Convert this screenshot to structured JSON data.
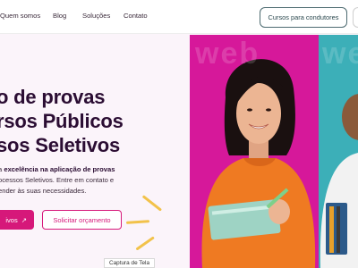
{
  "nav": {
    "items": [
      "Quem somos",
      "Blog",
      "Soluções",
      "Contato"
    ],
    "cta": "Cursos para condutores"
  },
  "hero": {
    "title_lines": [
      "o de provas",
      "rsos Públicos",
      "sos Seletivos"
    ],
    "para_line1_pre": "a ",
    "para_line1_bold": "excelência na aplicação de provas",
    "para_line2": "ocessos Seletivos. Entre em contato e",
    "para_line3": "ender às suas necessidades.",
    "primary_button": "ivos",
    "primary_arrow": "↗",
    "secondary_button": "Solicitar orçamento",
    "watermark_left": "web",
    "watermark_right": "web"
  },
  "tooltip": "Captura de Tela",
  "colors": {
    "accent": "#d6187a",
    "pink_panel": "#d6189a",
    "teal_panel": "#3cafb8",
    "title": "#2b0d33"
  }
}
